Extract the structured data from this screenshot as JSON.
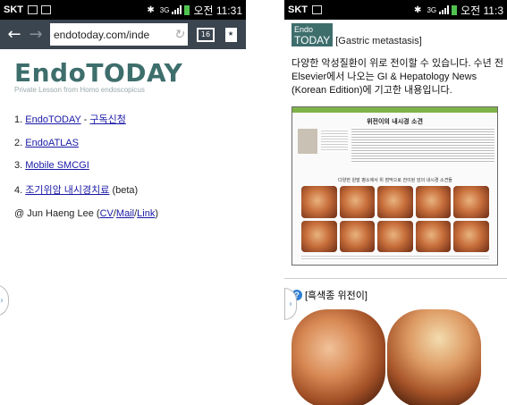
{
  "left_screen": {
    "status": {
      "carrier": "SKT",
      "network": "3G",
      "time_label": "오전 11:31"
    },
    "browser": {
      "url": "endotoday.com/inde",
      "tab_count": "16"
    },
    "logo": {
      "title": "EndoTODAY",
      "subtitle": "Private Lesson from Homo endoscopicus"
    },
    "menu": [
      {
        "num": "1.",
        "link": "EndoTODAY",
        "sep": " - ",
        "link2": "구독신청"
      },
      {
        "num": "2.",
        "link": "EndoATLAS"
      },
      {
        "num": "3.",
        "link": "Mobile SMCGI"
      },
      {
        "num": "4.",
        "link": "조기위암 내시경치료",
        "suffix": " (beta)"
      }
    ],
    "credit": {
      "prefix": "@ Jun Haeng Lee (",
      "cv": "CV",
      "slash1": "/",
      "mail": "Mail",
      "slash2": "/",
      "link": "Link",
      "suffix": ")"
    },
    "edge_tab": "›"
  },
  "right_screen": {
    "status": {
      "carrier": "SKT",
      "network": "3G",
      "time_label": "오전 11:3"
    },
    "logo": {
      "line1": "Endo",
      "line2": "TODAY",
      "tag": "[Gastric metastasis]"
    },
    "paragraph": "다양한 악성질환이 위로 전이할 수 있습니다. 수년 전 Elsevier에서 나오는 GI & Hepatology News (Korean Edition)에 기고한 내용입니다.",
    "article": {
      "title": "위전이의 내시경 소견",
      "caption": "다양한 원발 병소에서 위 점막으로 전이된 암의 내시경 소견들"
    },
    "subheading": "[흑색종 위전이]",
    "edge_tab": "›"
  }
}
